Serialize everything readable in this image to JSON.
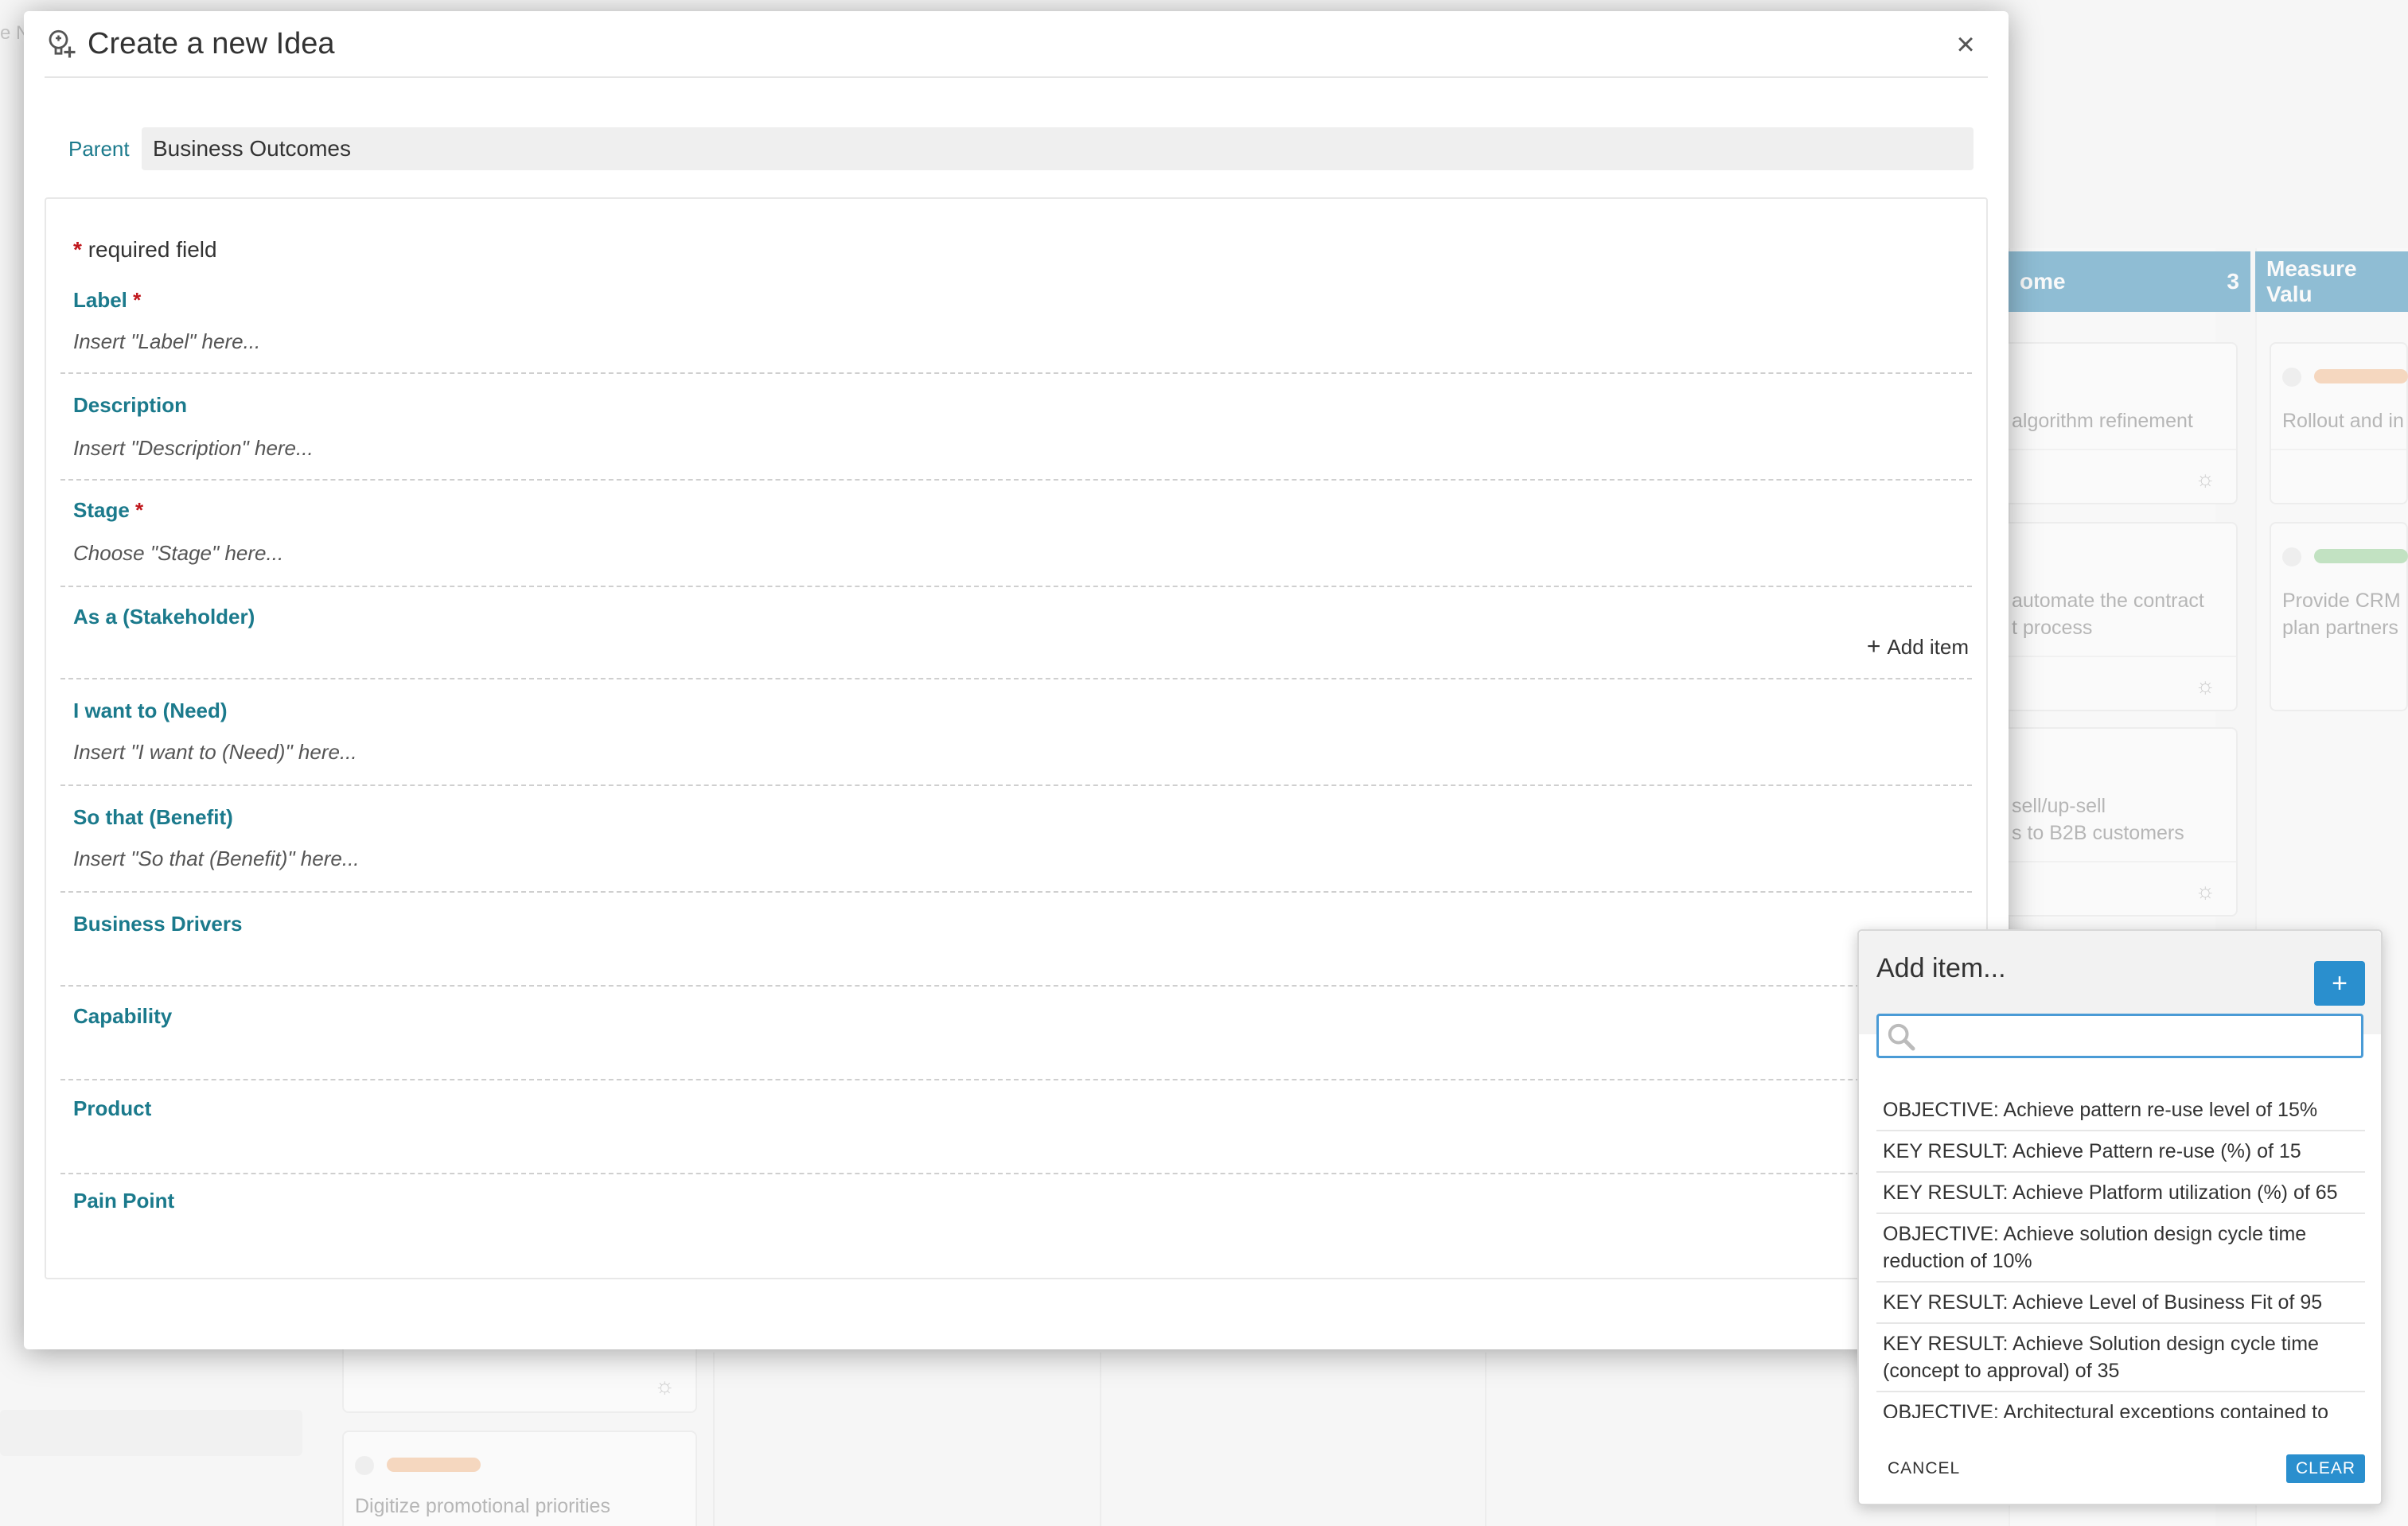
{
  "background": {
    "top_left_fragment": "e N",
    "columns": [
      {
        "title_fragment": "ome",
        "count": "3"
      },
      {
        "title_fragment": "Measure Valu"
      }
    ],
    "cards": [
      {
        "text": "algorithm refinement",
        "bar_color": ""
      },
      {
        "text": "automate the contract\nt process",
        "bar_color": ""
      },
      {
        "text": "sell/up-sell\ns to B2B customers",
        "bar_color": ""
      },
      {
        "text": "Rollout and in",
        "bar_color": "#f5b98a"
      },
      {
        "text": "Provide CRM\nplan partners",
        "bar_color": "#8fd08f"
      },
      {
        "text": "Digitize promotional priorities",
        "bar_color": "#f5b98a"
      }
    ],
    "gear_icon": "gear-icon"
  },
  "modal": {
    "title": "Create a new Idea",
    "title_icon": "lightbulb-plus-icon",
    "close_glyph": "×",
    "parent_label": "Parent",
    "parent_value": "Business Outcomes",
    "required_note_star": "*",
    "required_note_text": "required field",
    "fields": {
      "label": {
        "label": "Label",
        "required": "*",
        "placeholder": "Insert \"Label\" here..."
      },
      "description": {
        "label": "Description",
        "placeholder": "Insert \"Description\" here..."
      },
      "stage": {
        "label": "Stage",
        "required": "*",
        "placeholder": "Choose \"Stage\" here..."
      },
      "stakeholder": {
        "label": "As a (Stakeholder)",
        "add_item": "Add item"
      },
      "need": {
        "label": "I want to (Need)",
        "placeholder": "Insert \"I want to (Need)\" here..."
      },
      "benefit": {
        "label": "So that (Benefit)",
        "placeholder": "Insert \"So that (Benefit)\" here..."
      },
      "business_drivers": {
        "label": "Business Drivers"
      },
      "capability": {
        "label": "Capability"
      },
      "product": {
        "label": "Product"
      },
      "pain_point": {
        "label": "Pain Point"
      }
    }
  },
  "popup": {
    "title": "Add item...",
    "plus_label": "+",
    "search_value": "",
    "items": [
      "OBJECTIVE: Achieve pattern re-use level of 15%",
      "KEY RESULT: Achieve Pattern re-use (%) of 15",
      "KEY RESULT: Achieve Platform utilization (%) of 65",
      "OBJECTIVE: Achieve solution design cycle time reduction of 10%",
      "KEY RESULT: Achieve Level of Business Fit of 95",
      "KEY RESULT: Achieve Solution design cycle time (concept to approval) of 35",
      "OBJECTIVE: Architectural exceptions contained to"
    ],
    "cancel_label": "CANCEL",
    "clear_label": "CLEAR"
  }
}
